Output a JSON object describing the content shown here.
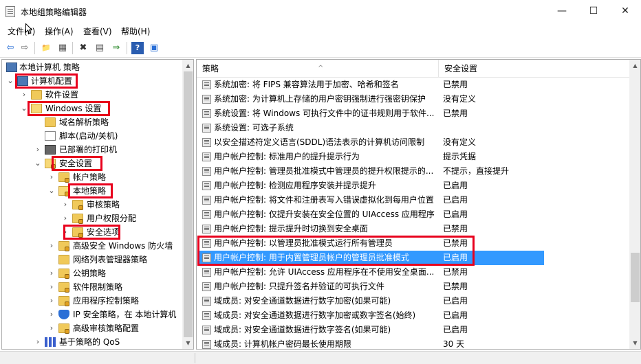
{
  "window": {
    "title": "本地组策略编辑器",
    "controls": {
      "minimize": "—",
      "maximize": "☐",
      "close": "✕"
    }
  },
  "menu": [
    "文件(F)",
    "操作(A)",
    "查看(V)",
    "帮助(H)"
  ],
  "toolbar": {
    "icons": [
      "back-arrow-icon",
      "forward-arrow-icon",
      "up-folder-icon",
      "show-hide-tree-icon",
      "delete-icon",
      "properties-icon",
      "export-list-icon",
      "help-icon",
      "console-icon"
    ],
    "glyphs": [
      "⇦",
      "⇨",
      "📁",
      "▦",
      "✖",
      "▤",
      "⇒",
      "?",
      "▣"
    ]
  },
  "tree": [
    {
      "label": "本地计算机 策略",
      "icon": "computer-policy-icon",
      "expander": ""
    },
    {
      "label": "计算机配置",
      "icon": "computer-icon",
      "expander": "⌄"
    },
    {
      "label": "软件设置",
      "icon": "folder-icon",
      "expander": "›"
    },
    {
      "label": "Windows 设置",
      "icon": "folder-open-icon",
      "expander": "⌄"
    },
    {
      "label": "域名解析策略",
      "icon": "folder-icon",
      "expander": ""
    },
    {
      "label": "脚本(启动/关机)",
      "icon": "script-icon",
      "expander": ""
    },
    {
      "label": "已部署的打印机",
      "icon": "printer-icon",
      "expander": "›"
    },
    {
      "label": "安全设置",
      "icon": "security-settings-icon",
      "expander": "⌄"
    },
    {
      "label": "帐户策略",
      "icon": "folder-lock-icon",
      "expander": "›"
    },
    {
      "label": "本地策略",
      "icon": "folder-lock-open-icon",
      "expander": "⌄"
    },
    {
      "label": "审核策略",
      "icon": "folder-lock-icon",
      "expander": "›"
    },
    {
      "label": "用户权限分配",
      "icon": "folder-lock-icon",
      "expander": "›"
    },
    {
      "label": "安全选项",
      "icon": "folder-lock-icon",
      "expander": "›"
    },
    {
      "label": "高级安全 Windows 防火墙",
      "icon": "folder-lock-icon",
      "expander": "›"
    },
    {
      "label": "网络列表管理器策略",
      "icon": "folder-icon",
      "expander": ""
    },
    {
      "label": "公钥策略",
      "icon": "folder-lock-icon",
      "expander": "›"
    },
    {
      "label": "软件限制策略",
      "icon": "folder-lock-icon",
      "expander": "›"
    },
    {
      "label": "应用程序控制策略",
      "icon": "folder-lock-icon",
      "expander": "›"
    },
    {
      "label": "IP 安全策略，在 本地计算机",
      "icon": "ip-security-icon",
      "expander": "›"
    },
    {
      "label": "高级审核策略配置",
      "icon": "folder-lock-icon",
      "expander": "›"
    },
    {
      "label": "基于策略的 QoS",
      "icon": "qos-chart-icon",
      "expander": "›"
    }
  ],
  "list": {
    "columns": {
      "policy": "策略",
      "setting": "安全设置"
    },
    "rows": [
      {
        "policy": "系统加密: 将 FIPS 兼容算法用于加密、哈希和签名",
        "setting": "已禁用"
      },
      {
        "policy": "系统加密: 为计算机上存储的用户密钥强制进行强密钥保护",
        "setting": "没有定义"
      },
      {
        "policy": "系统设置: 将 Windows 可执行文件中的证书规则用于软件...",
        "setting": "已禁用"
      },
      {
        "policy": "系统设置: 可选子系统",
        "setting": ""
      },
      {
        "policy": "以安全描述符定义语言(SDDL)语法表示的计算机访问限制",
        "setting": "没有定义"
      },
      {
        "policy": "用户帐户控制: 标准用户的提升提示行为",
        "setting": "提示凭据"
      },
      {
        "policy": "用户帐户控制: 管理员批准模式中管理员的提升权限提示的...",
        "setting": "不提示，直接提升"
      },
      {
        "policy": "用户帐户控制: 检测应用程序安装并提示提升",
        "setting": "已启用"
      },
      {
        "policy": "用户帐户控制: 将文件和注册表写入错误虚拟化到每用户位置",
        "setting": "已启用"
      },
      {
        "policy": "用户帐户控制: 仅提升安装在安全位置的 UIAccess 应用程序",
        "setting": "已启用"
      },
      {
        "policy": "用户帐户控制: 提示提升时切换到安全桌面",
        "setting": "已禁用"
      },
      {
        "policy": "用户帐户控制: 以管理员批准模式运行所有管理员",
        "setting": "已禁用"
      },
      {
        "policy": "用户帐户控制: 用于内置管理员帐户的管理员批准模式",
        "setting": "已启用"
      },
      {
        "policy": "用户帐户控制: 允许 UIAccess 应用程序在不使用安全桌面...",
        "setting": "已禁用"
      },
      {
        "policy": "用户帐户控制: 只提升签名并验证的可执行文件",
        "setting": "已禁用"
      },
      {
        "policy": "域成员: 对安全通道数据进行数字加密(如果可能)",
        "setting": "已启用"
      },
      {
        "policy": "域成员: 对安全通道数据进行数字加密或数字签名(始终)",
        "setting": "已启用"
      },
      {
        "policy": "域成员: 对安全通道数据进行数字签名(如果可能)",
        "setting": "已启用"
      },
      {
        "policy": "域成员: 计算机帐户密码最长使用期限",
        "setting": "30 天"
      }
    ],
    "selected_index": 12
  },
  "highlight_color": "#e8001c",
  "selection_color": "#3399ff"
}
